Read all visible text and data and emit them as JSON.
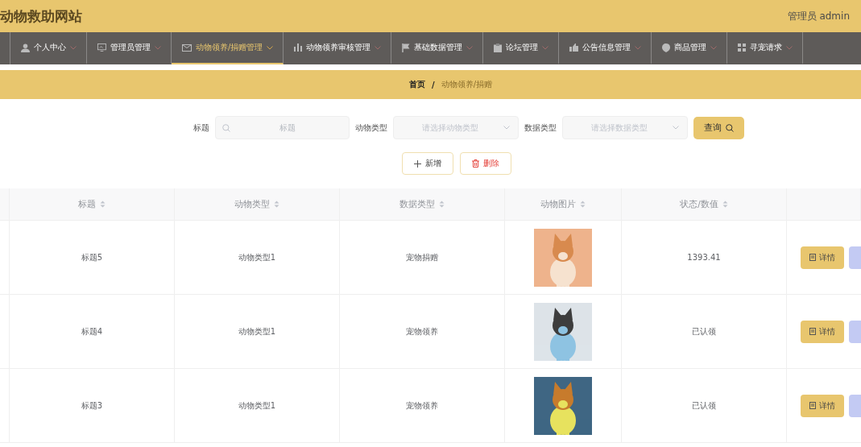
{
  "header": {
    "title": "动物救助网站",
    "user": "管理员 admin"
  },
  "nav": [
    {
      "label": "个人中心",
      "selected": false
    },
    {
      "label": "管理员管理",
      "selected": false
    },
    {
      "label": "动物领养/捐赠管理",
      "selected": true
    },
    {
      "label": "动物领养审核管理",
      "selected": false
    },
    {
      "label": "基础数据管理",
      "selected": false
    },
    {
      "label": "论坛管理",
      "selected": false
    },
    {
      "label": "公告信息管理",
      "selected": false
    },
    {
      "label": "商品管理",
      "selected": false
    },
    {
      "label": "寻宠请求",
      "selected": false
    }
  ],
  "breadcrumb": {
    "home": "首页",
    "separator": "/",
    "current": "动物领养/捐赠"
  },
  "search": {
    "fields": [
      {
        "kind": "input",
        "label": "标题",
        "placeholder": "标题"
      },
      {
        "kind": "select",
        "label": "动物类型",
        "placeholder": "请选择动物类型"
      },
      {
        "kind": "select",
        "label": "数据类型",
        "placeholder": "请选择数据类型"
      }
    ],
    "button": "查询"
  },
  "actions": [
    {
      "kind": "add",
      "label": "新增"
    },
    {
      "kind": "delete",
      "label": "删除"
    }
  ],
  "table": {
    "columns": [
      "标题",
      "动物类型",
      "数据类型",
      "动物图片",
      "状态/数值"
    ],
    "rows": [
      {
        "title": "标题5",
        "animal_type": "动物类型1",
        "data_type": "宠物捐赠",
        "status": "1393.41",
        "detail": "详情"
      },
      {
        "title": "标题4",
        "animal_type": "动物类型1",
        "data_type": "宠物领养",
        "status": "已认领",
        "detail": "详情"
      },
      {
        "title": "标题3",
        "animal_type": "动物类型1",
        "data_type": "宠物领养",
        "status": "已认领",
        "detail": "详情"
      }
    ]
  }
}
